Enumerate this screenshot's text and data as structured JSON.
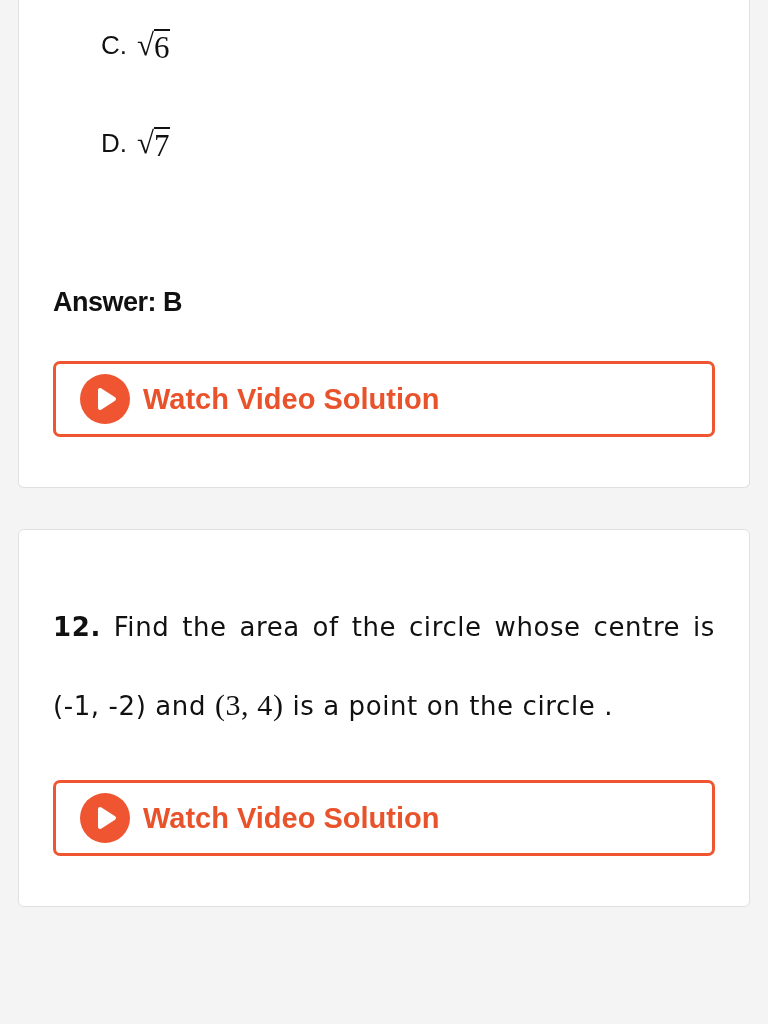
{
  "cards": [
    {
      "options": [
        {
          "label": "C.",
          "value": "√6"
        },
        {
          "label": "D.",
          "value": "√7"
        }
      ],
      "answer": "Answer: B",
      "button": {
        "label": "Watch Video Solution"
      }
    },
    {
      "question": {
        "number": "12.",
        "segments": [
          {
            "kind": "text",
            "text": "Find the area of the circle whose centre is (-1, -2) and "
          },
          {
            "kind": "math",
            "text": "(3, 4)"
          },
          {
            "kind": "text",
            "text": " is a point on the circle ."
          }
        ]
      },
      "button": {
        "label": "Watch Video Solution"
      }
    }
  ]
}
